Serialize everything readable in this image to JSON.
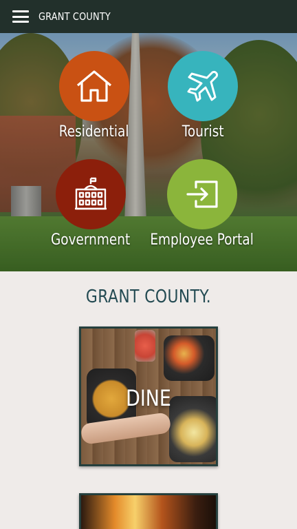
{
  "header": {
    "menu_icon": "hamburger-menu-icon",
    "title": "GRANT COUNTY",
    "background": "#22302b"
  },
  "hero": {
    "items": [
      {
        "label": "Residential",
        "icon": "house-icon",
        "color": "#c95113"
      },
      {
        "label": "Tourist",
        "icon": "airplane-icon",
        "color": "#37b4bd"
      },
      {
        "label": "Government",
        "icon": "government-building-icon",
        "color": "#8c1f0b"
      },
      {
        "label": "Employee Portal",
        "icon": "sign-in-icon",
        "color": "#8bb53b"
      }
    ]
  },
  "main": {
    "heading": "GRANT COUNTY.",
    "heading_color": "#234a52",
    "cards": [
      {
        "label": "DINE",
        "image": "food-table-photo"
      },
      {
        "label": "",
        "image": "fire-photo"
      }
    ]
  }
}
